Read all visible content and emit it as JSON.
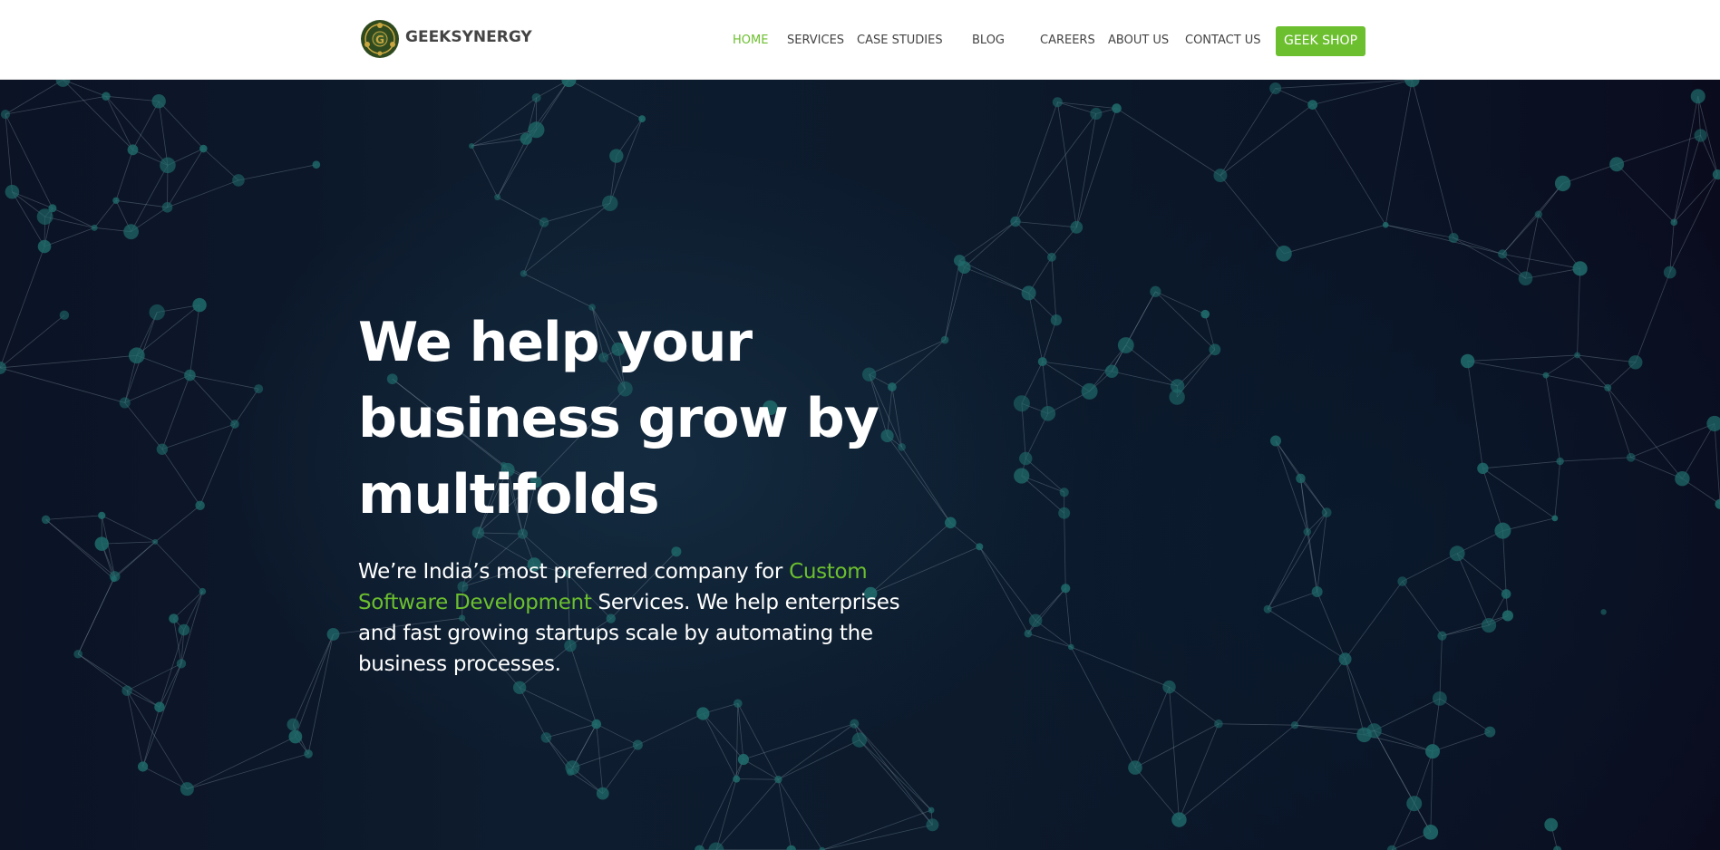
{
  "brand": {
    "name": "GEEKSYNERGY",
    "logo_letter": "G",
    "accent_color": "#6cbf2f",
    "logo_bg": "#2f4a1f"
  },
  "nav": {
    "items": [
      {
        "label": "HOME",
        "active": true
      },
      {
        "label": "SERVICES",
        "active": false
      },
      {
        "label": "CASE STUDIES",
        "active": false
      },
      {
        "label": "BLOG",
        "active": false
      },
      {
        "label": "CAREERS",
        "active": false
      },
      {
        "label": "ABOUT US",
        "active": false
      },
      {
        "label": "CONTACT US",
        "active": false
      }
    ],
    "shop_label": "GEEK SHOP"
  },
  "hero": {
    "title_lines": [
      "We help your",
      "business grow by",
      "multifolds"
    ],
    "desc_before": "We’re India’s most preferred company for ",
    "desc_highlight": "Custom Software Development",
    "desc_after": " Services. We help enterprises and fast growing startups scale by automating the business processes.",
    "background_color": "#0c1a2c",
    "node_color": "#1f6b6b",
    "line_color": "#8fa3b3"
  }
}
